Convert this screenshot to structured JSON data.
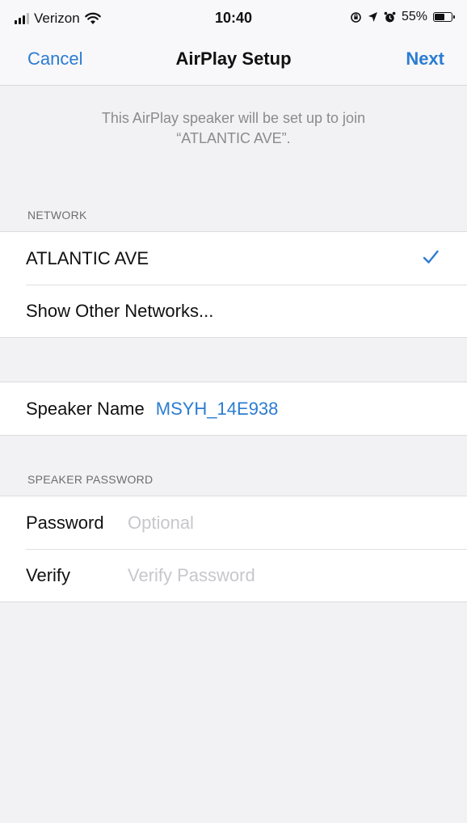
{
  "status_bar": {
    "carrier": "Verizon",
    "time": "10:40",
    "battery": "55%"
  },
  "nav": {
    "cancel_label": "Cancel",
    "title": "AirPlay Setup",
    "next_label": "Next"
  },
  "info": {
    "line1": "This AirPlay speaker will be set up to join",
    "line2": "“ATLANTIC AVE”."
  },
  "network": {
    "header": "NETWORK",
    "selected_network": "ATLANTIC AVE",
    "show_other_label": "Show Other Networks..."
  },
  "speaker": {
    "name_label": "Speaker Name",
    "name_value": "MSYH_14E938"
  },
  "password": {
    "header": "SPEAKER PASSWORD",
    "password_label": "Password",
    "password_placeholder": "Optional",
    "verify_label": "Verify",
    "verify_placeholder": "Verify Password"
  },
  "colors": {
    "accent": "#2b7cd3",
    "background": "#f2f2f5",
    "placeholder": "#c7c7cc"
  },
  "icons": {
    "signal": "cellular-signal-icon",
    "wifi": "wifi-icon",
    "location": "location-icon",
    "alarm": "alarm-icon",
    "lock_rotation": "orientation-lock-icon",
    "battery": "battery-icon",
    "checkmark": "checkmark-icon"
  }
}
